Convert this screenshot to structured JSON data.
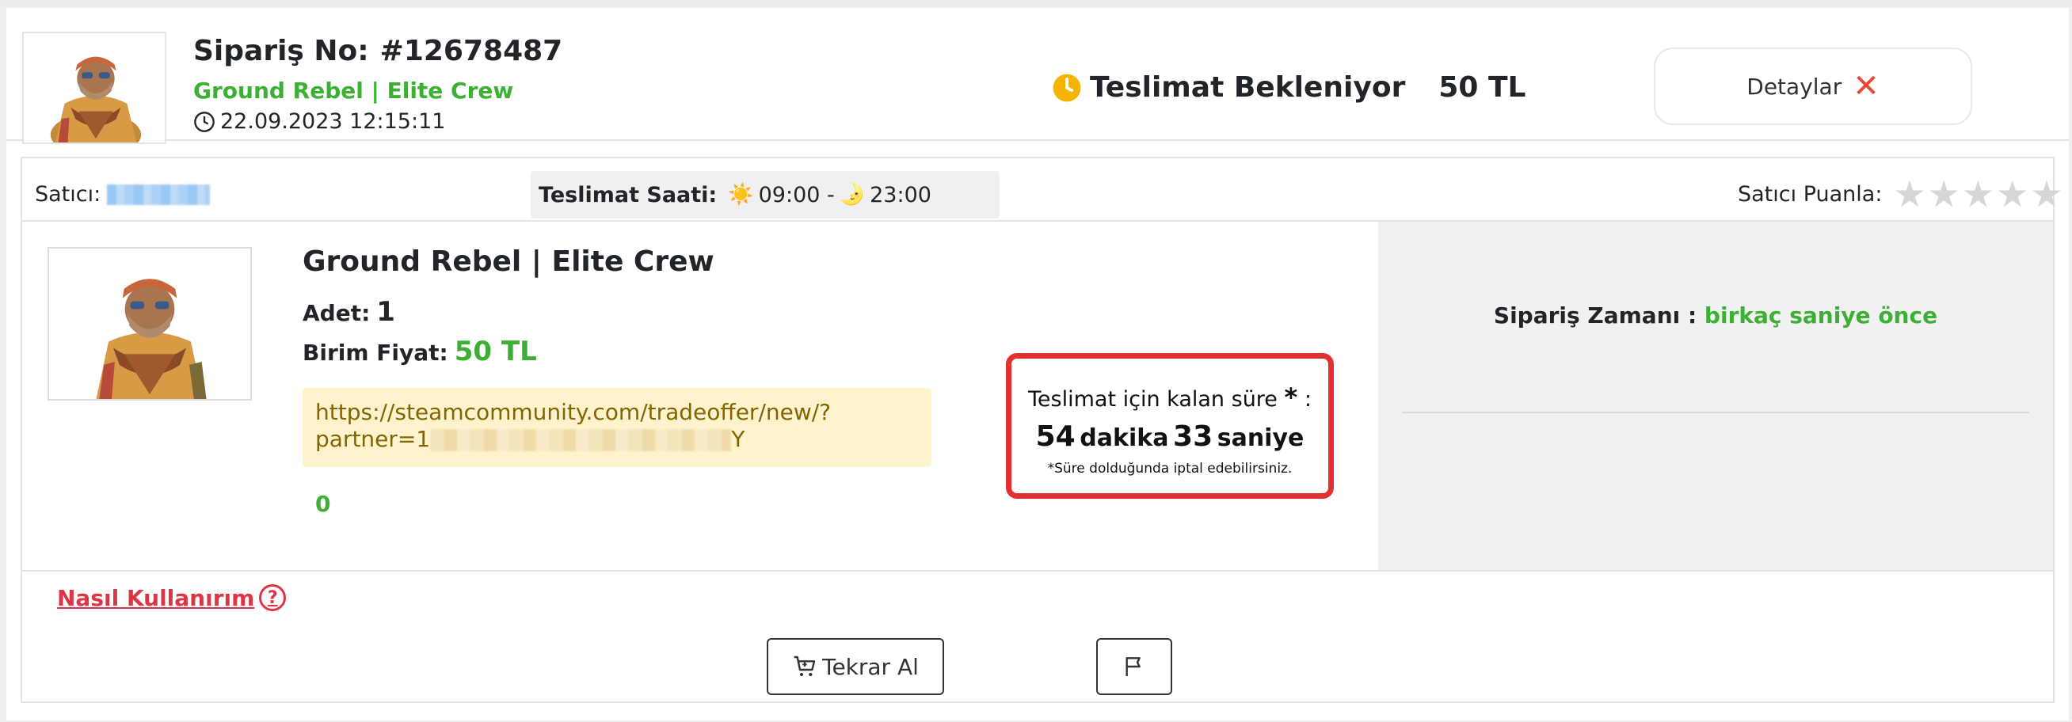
{
  "header": {
    "order_label": "Sipariş No:",
    "order_number": "#12678487",
    "item_name": "Ground Rebel | Elite Crew",
    "order_date": "22.09.2023 12:15:11",
    "status_text": "Teslimat Bekleniyor",
    "price": "50 TL",
    "details_label": "Detaylar",
    "details_icon": "close-x-icon"
  },
  "seller_row": {
    "seller_label": "Satıcı:",
    "delivery_hours_label": "Teslimat Saati:",
    "start_time": "09:00 -",
    "end_time": "23:00",
    "rate_label": "Satıcı Puanla:",
    "stars_count": 5,
    "stars_filled": 0
  },
  "product": {
    "name": "Ground Rebel | Elite Crew",
    "qty_label": "Adet:",
    "qty_value": "1",
    "unit_price_label": "Birim Fiyat:",
    "unit_price_value": "50 TL",
    "trade_link_line1": "https://steamcommunity.com/tradeoffer/new/?",
    "trade_link_prefix": "partner=1",
    "trade_link_suffix": "Y",
    "counter": "0"
  },
  "timer": {
    "label": "Teslimat için kalan süre",
    "asterisk": "*",
    "colon": ":",
    "minutes": "54",
    "minutes_label": "dakika",
    "seconds": "33",
    "seconds_label": "saniye",
    "note": "*Süre dolduğunda iptal edebilirsiniz."
  },
  "side_panel": {
    "order_time_label": "Sipariş Zamanı :",
    "order_time_value": "birkaç saniye önce"
  },
  "footer": {
    "how_to_label": "Nasıl Kullanırım",
    "rebuy_label": "Tekrar Al"
  },
  "colors": {
    "accent_green": "#3bb033",
    "alert_red": "#e0302f",
    "link_red": "#dc3545",
    "status_clock": "#f4b400"
  }
}
